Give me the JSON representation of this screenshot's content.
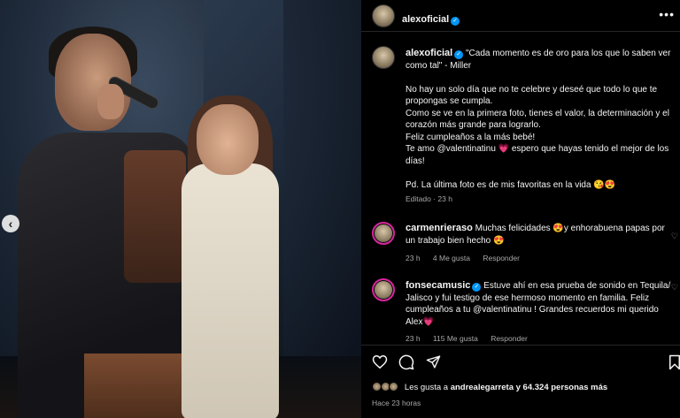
{
  "post": {
    "prev_icon": "chevron-left-icon"
  },
  "header": {
    "username": "alexoficial",
    "more": "•••"
  },
  "caption": {
    "username": "alexoficial",
    "line1": "\"Cada momento es de oro para los que lo saben ver como tal\" - Miller",
    "p1": "No hay un solo día que no te celebre y deseé que todo lo que te propongas se cumpla.",
    "p2": "Como se ve en la primera foto, tienes el valor, la determinación y el corazón más grande para lograrlo.",
    "p3": "Feliz cumpleaños a la más bebé!",
    "p4_a": "Te amo @valentinatinu",
    "p4_heart": "💗",
    "p4_b": "espero que hayas tenido el mejor de los días!",
    "p5": "Pd. La última foto es de mis favoritas en la vida 😘😍",
    "edited": "Editado · 23 h"
  },
  "comments": [
    {
      "username": "carmenrieraso",
      "text": "Muchas felicidades 😍y enhorabuena papas por un trabajo bien hecho 😍",
      "time": "23 h",
      "likes": "4 Me gusta",
      "reply": "Responder"
    },
    {
      "username": "fonsecamusic",
      "text": "Estuve ahí en esa prueba de sonido en Tequila/ Jalisco y fui testigo de ese hermoso momento en familia. Feliz cumpleaños a tu @valentinatinu ! Grandes recuerdos mi querido Alex💗",
      "time": "23 h",
      "likes": "115 Me gusta",
      "reply": "Responder"
    }
  ],
  "actions": {
    "like_icon": "heart-outline-icon",
    "comment_icon": "comment-icon",
    "share_icon": "send-icon",
    "save_icon": "bookmark-icon"
  },
  "likes": {
    "prefix": "Les gusta a",
    "user": "andrealegarreta",
    "suffix": "y 64.324 personas más"
  },
  "timestamp": "Hace 23 horas",
  "colors": {
    "background": "#000000",
    "verified": "#0095f6",
    "muted_text": "#a8a8a8"
  }
}
